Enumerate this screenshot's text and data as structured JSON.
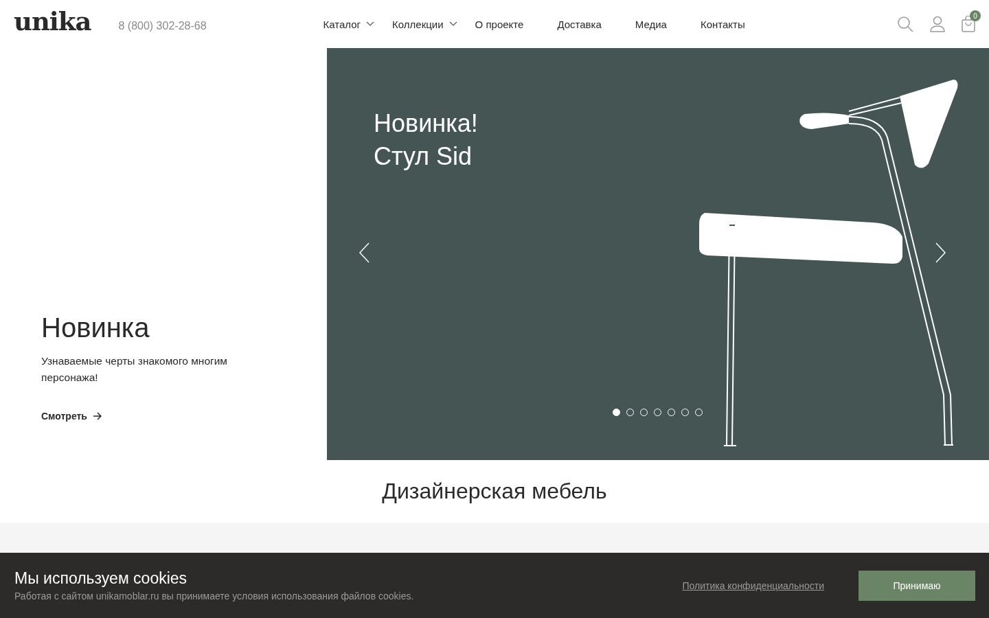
{
  "header": {
    "logo": "unika",
    "phone": "8 (800) 302-28-68",
    "nav": [
      {
        "label": "Каталог",
        "has_dropdown": true
      },
      {
        "label": "Коллекции",
        "has_dropdown": true
      },
      {
        "label": "О проекте",
        "has_dropdown": false
      },
      {
        "label": "Доставка",
        "has_dropdown": false
      },
      {
        "label": "Медиа",
        "has_dropdown": false
      },
      {
        "label": "Контакты",
        "has_dropdown": false
      }
    ],
    "cart_count": "0"
  },
  "hero": {
    "title": "Новинка",
    "text": "Узнаваемые черты знакомого многим персонажа!",
    "link": "Смотреть",
    "slide": {
      "lines": [
        "Новинка!",
        "Стул Sid"
      ],
      "dots": [
        {
          "selected": true
        },
        {
          "selected": false
        },
        {
          "selected": false
        },
        {
          "selected": false
        },
        {
          "selected": false
        },
        {
          "selected": false
        },
        {
          "selected": false
        }
      ]
    }
  },
  "section": {
    "title": "Дизайнерская мебель"
  },
  "cookie": {
    "title": "Мы используем cookies",
    "text": "Работая с сайтом unikamoblar.ru вы принимаете условия использования файлов cookies.",
    "policy_link": "Политика конфиденциальности",
    "accept": "Принимаю"
  }
}
